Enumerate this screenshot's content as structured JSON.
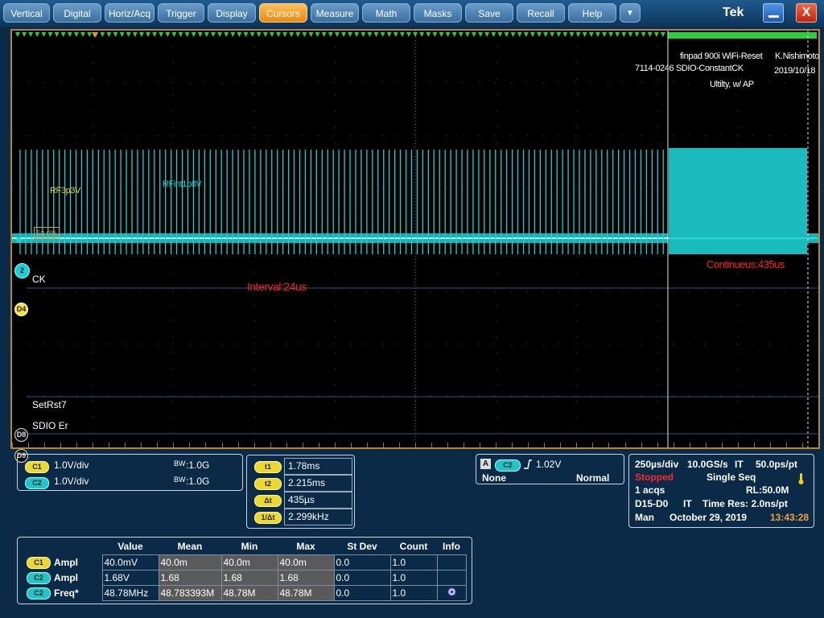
{
  "menu": {
    "items": [
      {
        "label": "Vertical"
      },
      {
        "label": "Digital"
      },
      {
        "label": "Horiz/Acq"
      },
      {
        "label": "Trigger"
      },
      {
        "label": "Display"
      },
      {
        "label": "Cursors",
        "active": true
      },
      {
        "label": "Measure"
      },
      {
        "label": "Math"
      },
      {
        "label": "Masks"
      },
      {
        "label": "Save"
      },
      {
        "label": "Recall"
      },
      {
        "label": "Help"
      }
    ],
    "dropdown_glyph": "▼",
    "brand": "Tek",
    "close_glyph": "X"
  },
  "display": {
    "annotations": {
      "title_line1": "finpad 900i WiFi-Reset",
      "author": "K.Nishimoto",
      "title_line2": "7114-0246 SDIO-ConstantCK",
      "date": "2019/10/18",
      "title_line3": "Ultilty, w/ AP"
    },
    "labels": {
      "rf3p3v": "RF3p3V",
      "rfint": "RFint1p8V",
      "interval": "Interval:24us",
      "continuous": "Continueus:435us",
      "trigger_level": "50.0%"
    },
    "channels": {
      "ch2_badge": "2",
      "d4_badge": "D4",
      "d4_label": "CK",
      "d8_badge": "D8",
      "d8_label": "SetRst7",
      "d9_badge": "D9",
      "d9_label": "SDIO Er"
    },
    "colors": {
      "ch2": "#1ecfd2",
      "ch1": "#ecd82e",
      "cursor_marker": "#2ecc40",
      "trigger": "#e09a30",
      "note": "#ff2222"
    }
  },
  "vertical": {
    "c1": {
      "badge": "C1",
      "scale": "1.0V/div",
      "bw_label": "BW",
      "bw": ":1.0G"
    },
    "c2": {
      "badge": "C2",
      "scale": "1.0V/div",
      "bw_label": "BW",
      "bw": ":1.0G"
    }
  },
  "cursors": {
    "t1": {
      "label": "t1",
      "value": "1.78ms"
    },
    "t2": {
      "label": "t2",
      "value": "2.215ms"
    },
    "dt": {
      "label": "Δt",
      "value": "435µs"
    },
    "inv": {
      "label": "1/Δt",
      "value": "2.299kHz"
    }
  },
  "trigger": {
    "source_letter": "A",
    "source": "C2",
    "level": "1.02V",
    "coupling": "None",
    "mode": "Normal"
  },
  "acquisition": {
    "time_div": "250µs/div",
    "sample_rate": "10.0GS/s",
    "it": "IT",
    "resolution": "50.0ps/pt",
    "state": "Stopped",
    "seq": "Single Seq",
    "acqs": "1 acqs",
    "record": "RL:50.0M",
    "digital": "D15-D0",
    "it2": "IT",
    "time_res": "Time Res: 2.0ns/pt",
    "mode": "Man",
    "date": "October 29, 2019",
    "time": "13:43:28"
  },
  "measurements": {
    "headers": [
      "Value",
      "Mean",
      "Min",
      "Max",
      "St Dev",
      "Count",
      "Info"
    ],
    "rows": [
      {
        "ch": "C1",
        "name": "Ampl",
        "value": "40.0mV",
        "mean": "40.0m",
        "min": "40.0m",
        "max": "40.0m",
        "stdev": "0.0",
        "count": "1.0",
        "info": ""
      },
      {
        "ch": "C2",
        "name": "Ampl",
        "value": "1.68V",
        "mean": "1.68",
        "min": "1.68",
        "max": "1.68",
        "stdev": "0.0",
        "count": "1.0",
        "info": ""
      },
      {
        "ch": "C2",
        "name": "Freq*",
        "value": "48.78MHz",
        "mean": "48.783393M",
        "min": "48.78M",
        "max": "48.78M",
        "stdev": "0.0",
        "count": "1.0",
        "info": "info-icon"
      }
    ]
  }
}
